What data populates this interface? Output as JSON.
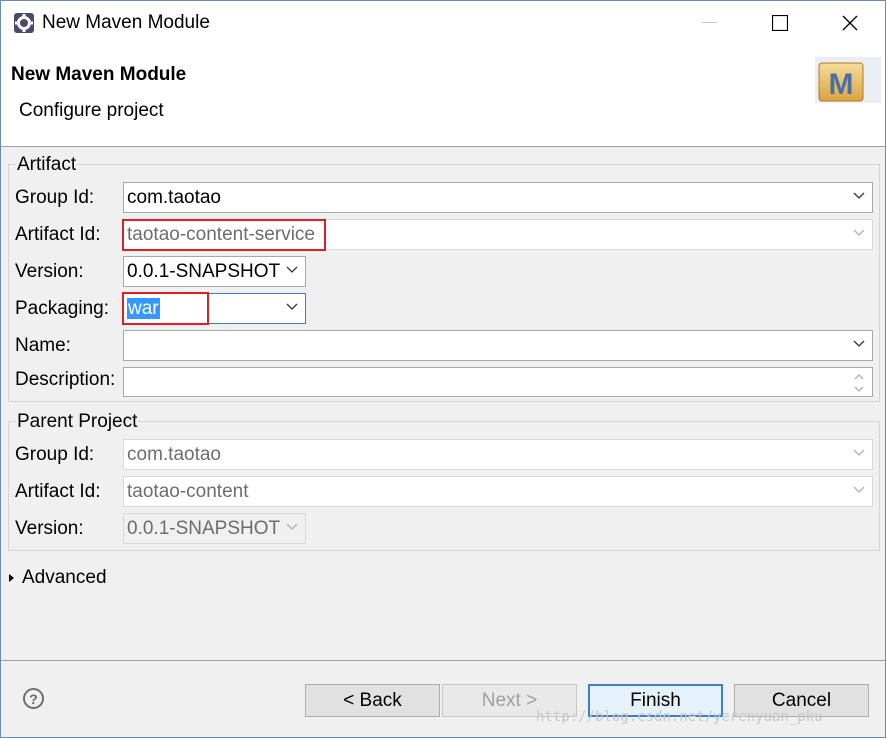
{
  "window": {
    "title": "New Maven Module"
  },
  "header": {
    "title": "New Maven Module",
    "subtitle": "Configure project",
    "logo_letter": "M"
  },
  "artifact": {
    "legend": "Artifact",
    "group_id_label": "Group Id:",
    "group_id_value": "com.taotao",
    "artifact_id_label": "Artifact Id:",
    "artifact_id_value": "taotao-content-service",
    "version_label": "Version:",
    "version_value": "0.0.1-SNAPSHOT",
    "packaging_label": "Packaging:",
    "packaging_value": "war",
    "name_label": "Name:",
    "name_value": "",
    "description_label": "Description:",
    "description_value": ""
  },
  "parent": {
    "legend": "Parent Project",
    "group_id_label": "Group Id:",
    "group_id_value": "com.taotao",
    "artifact_id_label": "Artifact Id:",
    "artifact_id_value": "taotao-content",
    "version_label": "Version:",
    "version_value": "0.0.1-SNAPSHOT"
  },
  "advanced_label": "Advanced",
  "buttons": {
    "help": "?",
    "back": "< Back",
    "next": "Next >",
    "finish": "Finish",
    "cancel": "Cancel"
  },
  "watermark": "http://blog.csdn.net/yerenyuan_pku",
  "colors": {
    "highlight": "#e02020",
    "selection": "#3399ff",
    "default_button_border": "#3b7fd0"
  }
}
